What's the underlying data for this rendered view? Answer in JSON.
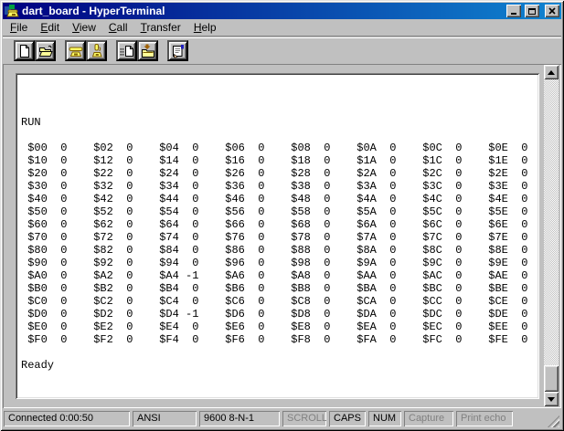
{
  "window": {
    "title": "dart_board - HyperTerminal"
  },
  "titlebar": {
    "buttons": [
      {
        "name": "minimize"
      },
      {
        "name": "maximize"
      },
      {
        "name": "close",
        "glyph": "x"
      }
    ]
  },
  "menu": {
    "items": [
      {
        "label": "File"
      },
      {
        "label": "Edit"
      },
      {
        "label": "View"
      },
      {
        "label": "Call"
      },
      {
        "label": "Transfer"
      },
      {
        "label": "Help"
      }
    ]
  },
  "toolbar": {
    "buttons": [
      {
        "name": "new"
      },
      {
        "name": "open"
      },
      {
        "name": "call"
      },
      {
        "name": "disconnect"
      },
      {
        "name": "send"
      },
      {
        "name": "receive"
      },
      {
        "name": "properties"
      }
    ]
  },
  "terminal": {
    "lines": [
      "",
      "",
      "",
      "RUN",
      "",
      " $00  0    $02  0    $04  0    $06  0    $08  0    $0A  0    $0C  0    $0E  0",
      " $10  0    $12  0    $14  0    $16  0    $18  0    $1A  0    $1C  0    $1E  0",
      " $20  0    $22  0    $24  0    $26  0    $28  0    $2A  0    $2C  0    $2E  0",
      " $30  0    $32  0    $34  0    $36  0    $38  0    $3A  0    $3C  0    $3E  0",
      " $40  0    $42  0    $44  0    $46  0    $48  0    $4A  0    $4C  0    $4E  0",
      " $50  0    $52  0    $54  0    $56  0    $58  0    $5A  0    $5C  0    $5E  0",
      " $60  0    $62  0    $64  0    $66  0    $68  0    $6A  0    $6C  0    $6E  0",
      " $70  0    $72  0    $74  0    $76  0    $78  0    $7A  0    $7C  0    $7E  0",
      " $80  0    $82  0    $84  0    $86  0    $88  0    $8A  0    $8C  0    $8E  0",
      " $90  0    $92  0    $94  0    $96  0    $98  0    $9A  0    $9C  0    $9E  0",
      " $A0  0    $A2  0    $A4 -1    $A6  0    $A8  0    $AA  0    $AC  0    $AE  0",
      " $B0  0    $B2  0    $B4  0    $B6  0    $B8  0    $BA  0    $BC  0    $BE  0",
      " $C0  0    $C2  0    $C4  0    $C6  0    $C8  0    $CA  0    $CC  0    $CE  0",
      " $D0  0    $D2  0    $D4 -1    $D6  0    $D8  0    $DA  0    $DC  0    $DE  0",
      " $E0  0    $E2  0    $E4  0    $E6  0    $E8  0    $EA  0    $EC  0    $EE  0",
      " $F0  0    $F2  0    $F4  0    $F6  0    $F8  0    $FA  0    $FC  0    $FE  0",
      "",
      "Ready"
    ]
  },
  "statusbar": {
    "panels": [
      {
        "label": "Connected 0:00:50",
        "state": "active"
      },
      {
        "label": "ANSI",
        "state": "active"
      },
      {
        "label": "9600 8-N-1",
        "state": "active"
      },
      {
        "label": "SCROLL",
        "state": "disabled"
      },
      {
        "label": "CAPS",
        "state": "active"
      },
      {
        "label": "NUM",
        "state": "active"
      },
      {
        "label": "Capture",
        "state": "disabled"
      },
      {
        "label": "Print echo",
        "state": "disabled"
      }
    ]
  },
  "colors": {
    "titlebar_start": "#000080",
    "titlebar_end": "#1084d0",
    "chrome": "#c0c0c0",
    "terminal_bg": "#ffffff",
    "terminal_fg": "#000000",
    "disabled_text": "#808080"
  }
}
